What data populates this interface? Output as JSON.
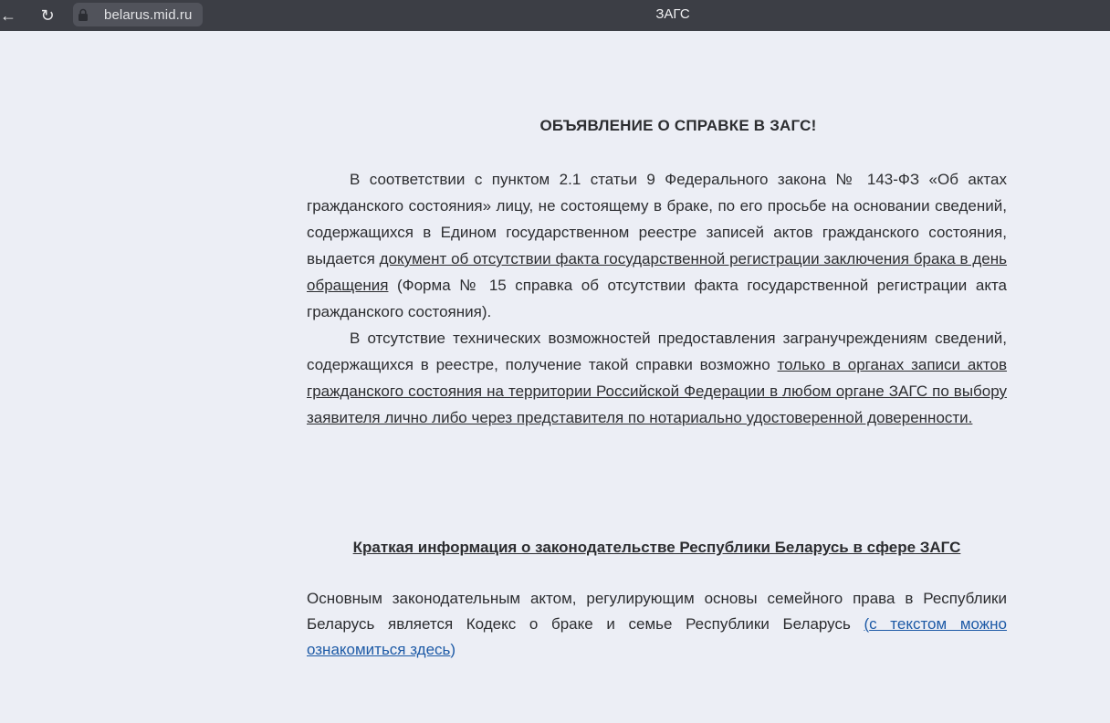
{
  "browser": {
    "url": "belarus.mid.ru",
    "tab_title": "ЗАГС",
    "back_icon": "←",
    "reload_icon": "↻"
  },
  "article": {
    "notice_heading": "ОБЪЯВЛЕНИЕ О СПРАВКЕ В ЗАГС!",
    "p1_a": "В соответствии с пунктом 2.1 статьи 9 Федерального закона № 143-ФЗ «Об актах гражданского состояния» лицу, не состоящему в браке, по его просьбе на основании сведений, содержащихся в Едином государственном реестре записей актов гражданского состояния, выдается ",
    "p1_link": "документ об отсутствии факта государственной регистрации заключения брака в день обращения",
    "p1_b": " (Форма № 15 справка об отсутствии факта государственной регистрации акта гражданского состояния).",
    "p2_a": "В отсутствие технических возможностей предоставления загранучреждениям сведений, содержащихся в реестре, получение такой справки возможно ",
    "p2_underlined": "только в органах записи актов гражданского состояния на территории Российской Федерации в любом органе ЗАГС по выбору заявителя лично либо через представителя по нотариально удостоверенной доверенности. ",
    "section_heading": "Краткая информация о законодательстве Республики Беларусь в сфере ЗАГС",
    "p3_a": "Основным законодательным актом, регулирующим основы семейного права в Республики Беларусь  является Кодекс о браке и семье Республики Беларусь ",
    "p3_paren_open": "(",
    "p3_link": "с текстом можно ознакомиться здесь",
    "p3_paren_close": ")"
  },
  "colors": {
    "page_bg": "#eceef5",
    "topbar_bg": "#3c3e45",
    "text": "#2c2d30",
    "link": "#1d5aa6"
  }
}
